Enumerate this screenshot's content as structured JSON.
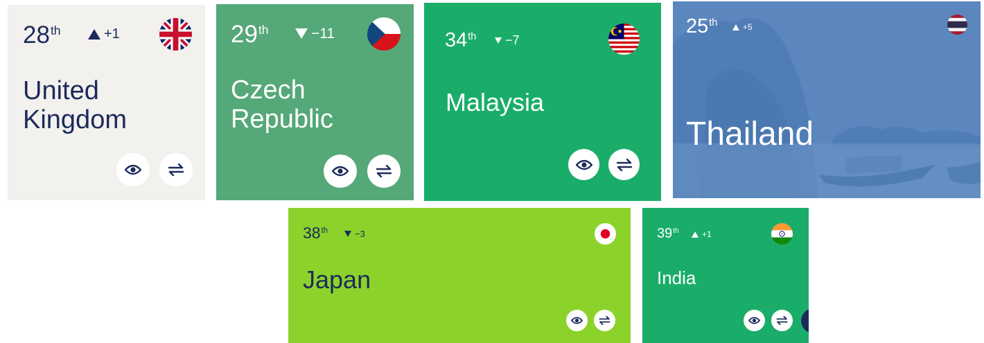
{
  "colors": {
    "navy": "#1c2a5b",
    "uk_card": "#f2f1ed",
    "czech_card": "#55a877",
    "green_card": "#1aad6a",
    "thailand_card": "#5d88bf",
    "japan_card": "#8bd32a"
  },
  "icons": {
    "view": "eye-icon",
    "compare": "swap-arrows-icon"
  },
  "cards": [
    {
      "country": "United\nKingdom",
      "rank": "28",
      "suffix": "th",
      "change": "+1",
      "direction": "up",
      "flag": "uk-flag-icon"
    },
    {
      "country": "Czech\nRepublic",
      "rank": "29",
      "suffix": "th",
      "change": "−11",
      "direction": "down",
      "flag": "czech-flag-icon"
    },
    {
      "country": "Malaysia",
      "rank": "34",
      "suffix": "th",
      "change": "−7",
      "direction": "down",
      "flag": "malaysia-flag-icon"
    },
    {
      "country": "Thailand",
      "rank": "25",
      "suffix": "th",
      "change": "+5",
      "direction": "up",
      "flag": "thailand-flag-icon"
    },
    {
      "country": "Japan",
      "rank": "38",
      "suffix": "th",
      "change": "−3",
      "direction": "down",
      "flag": "japan-flag-icon"
    },
    {
      "country": "India",
      "rank": "39",
      "suffix": "th",
      "change": "+1",
      "direction": "up",
      "flag": "india-flag-icon"
    }
  ]
}
